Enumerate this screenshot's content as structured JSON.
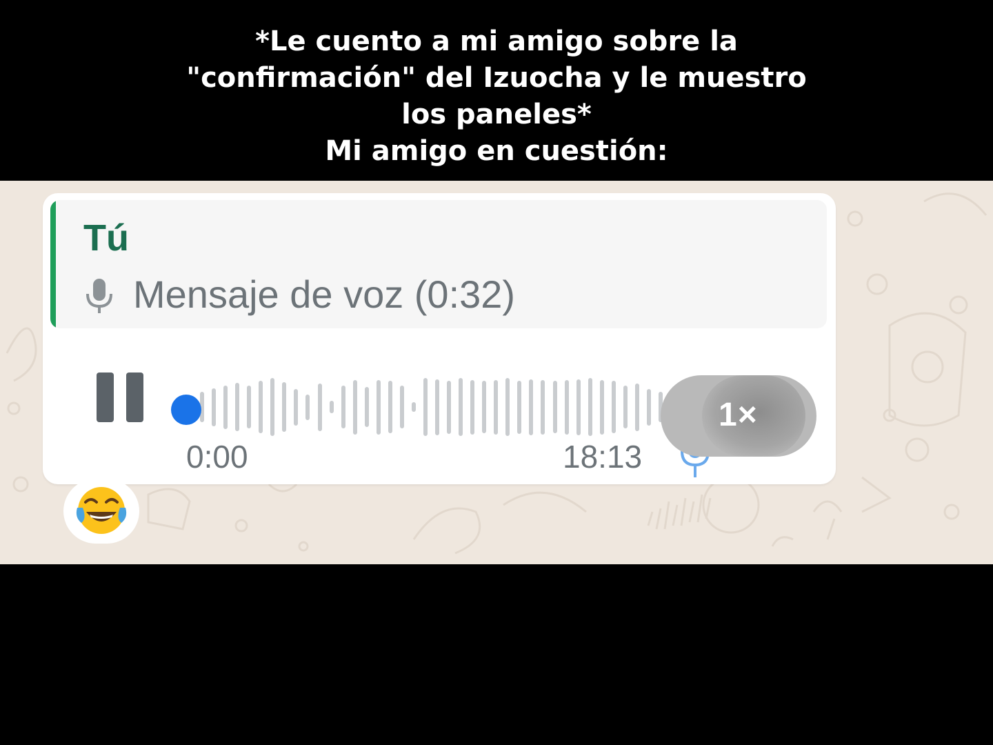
{
  "caption": {
    "lines": [
      "*Le cuento a mi amigo sobre la",
      "\"confirmación\" del Izuocha y le muestro",
      "los paneles*",
      "Mi amigo en cuestión:"
    ]
  },
  "message": {
    "quoted": {
      "author": "Tú",
      "icon": "mic-icon",
      "text": "Mensaje de voz (0:32)"
    },
    "voice_note": {
      "state": "playing",
      "current_time": "0:00",
      "duration": "18:13",
      "progress": 0,
      "speed": "1×"
    },
    "reaction": {
      "emoji_name": "face-with-tears-of-joy-icon"
    }
  },
  "colors": {
    "quote_accent": "#1f9e5a",
    "author": "#1b6e50",
    "seek_dot": "#1a73e8",
    "played_mic": "#6aa9ec",
    "chat_background": "#efe7de"
  }
}
